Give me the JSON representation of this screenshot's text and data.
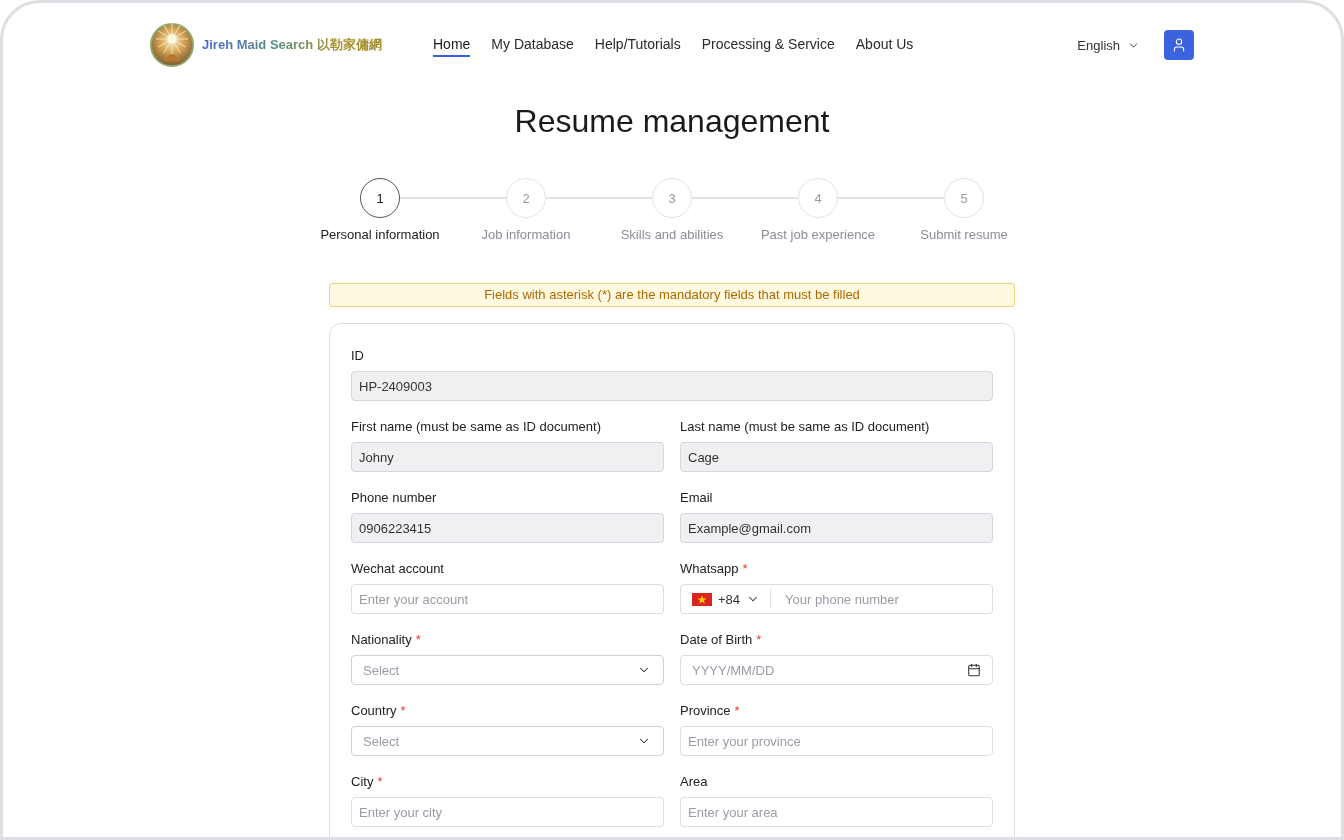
{
  "header": {
    "brand": "Jireh Maid Search 以勒家傭網",
    "nav": [
      {
        "label": "Home",
        "selected": true
      },
      {
        "label": "My Database",
        "selected": false
      },
      {
        "label": "Help/Tutorials",
        "selected": false
      },
      {
        "label": "Processing & Service",
        "selected": false
      },
      {
        "label": "About Us",
        "selected": false
      }
    ],
    "language": "English"
  },
  "title": "Resume management",
  "steps": [
    {
      "number": "1",
      "label": "Personal information",
      "selected": true
    },
    {
      "number": "2",
      "label": "Job information",
      "selected": false
    },
    {
      "number": "3",
      "label": "Skills and abilities",
      "selected": false
    },
    {
      "number": "4",
      "label": "Past job experience",
      "selected": false
    },
    {
      "number": "5",
      "label": "Submit resume",
      "selected": false
    }
  ],
  "notice": "Fields with asterisk (*) are the mandatory fields that must be filled",
  "form": {
    "rows": [
      [
        {
          "kind": "text",
          "label": "ID",
          "value": "HP-2409003",
          "disabled": true
        }
      ],
      [
        {
          "kind": "text",
          "label": "First name (must be same as ID document)",
          "value": "Johny",
          "disabled": true
        },
        {
          "kind": "text",
          "label": "Last name (must be same as ID document)",
          "value": "Cage",
          "disabled": true
        }
      ],
      [
        {
          "kind": "text",
          "label": "Phone number",
          "value": "0906223415",
          "disabled": true
        },
        {
          "kind": "text",
          "label": "Email",
          "value": "Example@gmail.com",
          "disabled": true
        }
      ],
      [
        {
          "kind": "text",
          "label": "Wechat account",
          "placeholder": "Enter your account",
          "disabled": false
        },
        {
          "kind": "phone",
          "label": "Whatsapp",
          "required_mark": "*",
          "dial_code": "+84",
          "placeholder": "Your phone number",
          "disabled": false
        }
      ],
      [
        {
          "kind": "select",
          "label": "Nationality",
          "required_mark": "*",
          "placeholder": "Select",
          "disabled": false
        },
        {
          "kind": "date",
          "label": "Date of Birth",
          "required_mark": "*",
          "placeholder": "YYYY/MM/DD",
          "disabled": false
        }
      ],
      [
        {
          "kind": "select",
          "label": "Country",
          "required_mark": "*",
          "placeholder": "Select",
          "disabled": false
        },
        {
          "kind": "text",
          "label": "Province",
          "required_mark": "*",
          "placeholder": "Enter your province",
          "disabled": false
        }
      ],
      [
        {
          "kind": "text",
          "label": "City",
          "required_mark": "*",
          "placeholder": "Enter your city",
          "disabled": false
        },
        {
          "kind": "text",
          "label": "Area",
          "placeholder": "Enter your area",
          "disabled": false
        }
      ]
    ]
  }
}
